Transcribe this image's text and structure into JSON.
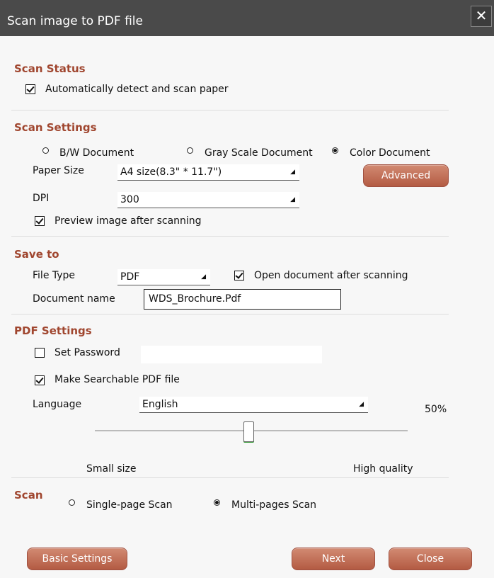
{
  "window": {
    "title": "Scan image to PDF file",
    "close_glyph": "✕"
  },
  "scan_status": {
    "heading": "Scan Status",
    "auto_detect_label": "Automatically detect and scan  paper",
    "auto_detect_checked": true
  },
  "scan_settings": {
    "heading": "Scan Settings",
    "color_modes": [
      {
        "label": "B/W Document",
        "selected": false
      },
      {
        "label": "Gray Scale Document",
        "selected": false
      },
      {
        "label": "Color Document",
        "selected": true
      }
    ],
    "paper_size_label": "Paper Size",
    "paper_size_value": "A4 size(8.3\" * 11.7\")",
    "dpi_label": "DPI",
    "dpi_value": "300",
    "advanced_button": "Advanced",
    "preview_label": "Preview image after scanning",
    "preview_checked": true
  },
  "save_to": {
    "heading": "Save to",
    "file_type_label": "File Type",
    "file_type_value": "PDF",
    "open_doc_label": "Open document after scanning",
    "open_doc_checked": true,
    "doc_name_label": "Document name",
    "doc_name_value": "WDS_Brochure.Pdf"
  },
  "pdf_settings": {
    "heading": "PDF Settings",
    "password_label": "Set Password",
    "password_checked": false,
    "password_value": "",
    "searchable_label": "Make Searchable PDF file",
    "searchable_checked": true,
    "language_label": "Language",
    "language_value": "English",
    "quality_percent": "50%",
    "quality_level": 0.5,
    "small_size_label": "Small size",
    "high_quality_label": "High quality"
  },
  "scan": {
    "heading": "Scan",
    "modes": [
      {
        "label": "Single-page Scan",
        "selected": false
      },
      {
        "label": "Multi-pages Scan",
        "selected": true
      }
    ]
  },
  "footer": {
    "basic_settings": "Basic Settings",
    "next": "Next",
    "close": "Close"
  },
  "colors": {
    "accent": "#a0462f",
    "button": "#c06d56",
    "titlebar": "#4a4a4a"
  }
}
